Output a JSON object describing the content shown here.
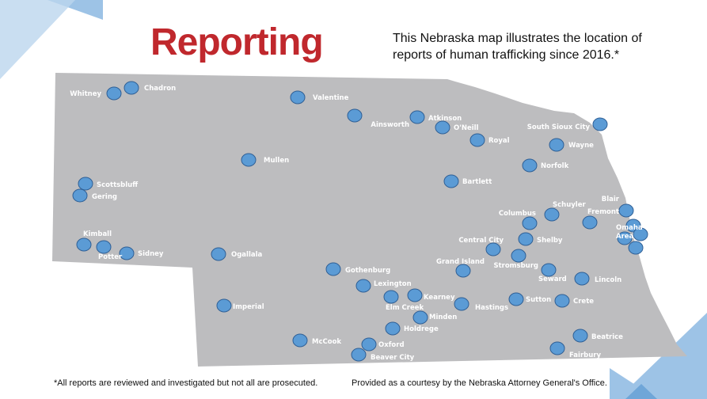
{
  "title": "Reporting",
  "description": "This Nebraska map illustrates the location of reports of human trafficking since 2016.*",
  "footnote": "*All reports are reviewed and investigated but not all are prosecuted.",
  "credit": "Provided as a courtesy by the Nebraska Attorney General's Office.",
  "colors": {
    "title": "#c0282d",
    "state_fill": "#bdbdbf",
    "marker": "#5b9bd5",
    "marker_stroke": "#2f5f95",
    "accent": "#9dc3e6"
  },
  "locations": [
    "Whitney",
    "Chadron",
    "Valentine",
    "Ainsworth",
    "Atkinson",
    "O'Neill",
    "Royal",
    "South Sioux City",
    "Wayne",
    "Norfolk",
    "Mullen",
    "Bartlett",
    "Scottsbluff",
    "Gering",
    "Kimball",
    "Potter",
    "Sidney",
    "Ogallala",
    "Columbus",
    "Schuyler",
    "Blair",
    "Fremont",
    "Omaha",
    "Area",
    "Central City",
    "Shelby",
    "Stromsburg",
    "Grand Island",
    "Gothenburg",
    "Seward",
    "Lincoln",
    "Lexington",
    "Elm Creek",
    "Kearney",
    "Hastings",
    "Sutton",
    "Crete",
    "Imperial",
    "Minden",
    "Holdrege",
    "Beatrice",
    "McCook",
    "Oxford",
    "Beaver City",
    "Fairbury"
  ]
}
